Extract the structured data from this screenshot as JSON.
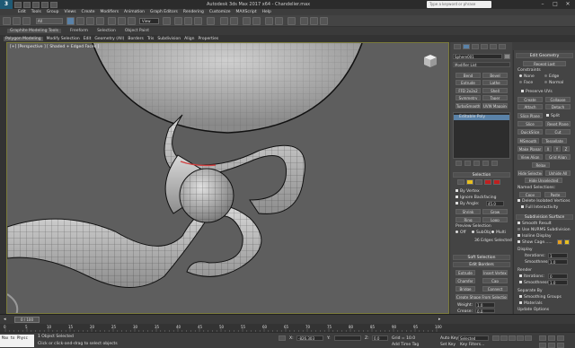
{
  "window": {
    "title": "Autodesk 3ds Max 2017 x64 - Chandelier.max",
    "logo": "3",
    "search_placeholder": "Type a keyword or phrase"
  },
  "menu": [
    "Edit",
    "Tools",
    "Group",
    "Views",
    "Create",
    "Modifiers",
    "Animation",
    "Graph Editors",
    "Rendering",
    "Customize",
    "MAXScript",
    "Help"
  ],
  "toolbar": {
    "selection_filter": "All",
    "view_dropdown": "View"
  },
  "ribbon": {
    "title": "Graphite Modeling Tools",
    "tabs": [
      "Freeform",
      "Selection",
      "Object Paint"
    ],
    "subtabs": [
      "Polygon Modeling",
      "Modify Selection",
      "Edit",
      "Geometry (All)",
      "Borders",
      "Tris",
      "Subdivision",
      "Align",
      "Properties"
    ]
  },
  "viewport": {
    "label": "[+] [Perspective ] [ Shaded + Edged Faces ]"
  },
  "command_panel": {
    "object_name": "Sphere001",
    "modifier_list": "Modifier List",
    "mod_buttons": [
      [
        "Bend",
        "Bevel"
      ],
      [
        "Extrude",
        "Lathe"
      ],
      [
        "FFD 2x2x2",
        "Shell"
      ],
      [
        "Symmetry",
        "Taper"
      ],
      [
        "TurboSmooth",
        "UVW Mapping Clr"
      ]
    ],
    "stack_item": "Editable Poly",
    "selection_header": "Selection",
    "by_vertex": "By Vertex",
    "ignore_backfacing": "Ignore Backfacing",
    "by_angle": "By Angle:",
    "angle_value": "45.0",
    "shrink": "Shrink",
    "grow": "Grow",
    "ring": "Ring",
    "loop": "Loop",
    "preview_label": "Preview Selection",
    "preview_off": "Off",
    "preview_subobj": "SubObj",
    "preview_multi": "Multi",
    "selected_status": "36 Edges Selected",
    "soft_selection": "Soft Selection",
    "edit_borders": "Edit Borders",
    "extrude": "Extrude",
    "insert_vertex": "Insert Vertex",
    "chamfer": "Chamfer",
    "cap": "Cap",
    "bridge": "Bridge",
    "connect": "Connect",
    "create_shape": "Create Shape From Selection",
    "weight_label": "Weight:",
    "weight_value": "1.0",
    "crease_label": "Crease:",
    "crease_value": "0.0",
    "edit_tri": "Edit Tri.",
    "turn": "Turn"
  },
  "right_panel": {
    "edit_geometry": "Edit Geometry",
    "repeat_last": "Repeat Last",
    "constraints": "Constraints",
    "none": "None",
    "edge": "Edge",
    "face": "Face",
    "normal": "Normal",
    "preserve_uvs": "Preserve UVs",
    "create": "Create",
    "collapse": "Collapse",
    "attach": "Attach",
    "detach": "Detach",
    "slice_plane": "Slice Plane",
    "split": "Split",
    "slice": "Slice",
    "reset_plane": "Reset Plane",
    "quickslice": "QuickSlice",
    "cut": "Cut",
    "msmooth": "MSmooth",
    "tessellate": "Tessellate",
    "make_planar": "Make Planar",
    "x": "X",
    "y": "Y",
    "z": "Z",
    "view_align": "View Align",
    "grid_align": "Grid Align",
    "relax": "Relax",
    "hide_selected": "Hide Selected",
    "unhide_all": "Unhide All",
    "hide_unselected": "Hide Unselected",
    "named_selections": "Named Selections:",
    "copy": "Copy",
    "paste": "Paste",
    "delete_isolated": "Delete Isolated Vertices",
    "full_interactivity": "Full Interactivity",
    "subdivision_surface": "Subdivision Surface",
    "smooth_result": "Smooth Result",
    "use_nurms": "Use NURMS Subdivision",
    "isoline_display": "Isoline Display",
    "show_cage": "Show Cage......",
    "display": "Display",
    "iterations": "Iterations:",
    "iter_value": "1",
    "smoothness": "Smoothness:",
    "smooth_value": "1.0",
    "render": "Render",
    "render_iter": "Iterations:",
    "render_iter_value": "0",
    "render_smooth": "Smoothness:",
    "render_smooth_value": "1.0",
    "separate_by": "Separate By",
    "smoothing_groups": "Smoothing Groups",
    "materials": "Materials",
    "update_options": "Update Options",
    "always": "Always",
    "when_rendering": "When Rendering",
    "manually": "Manually"
  },
  "timeline": {
    "frame": "0 / 100",
    "ticks": [
      "0",
      "5",
      "10",
      "15",
      "20",
      "25",
      "30",
      "35",
      "40",
      "45",
      "50",
      "55",
      "60",
      "65",
      "70",
      "75",
      "80",
      "85",
      "90",
      "95",
      "100"
    ]
  },
  "status": {
    "maxscript_line1": "Max to Physc",
    "maxscript_line2": "",
    "selection_status": "1 Object Selected",
    "prompt": "Click or click-and-drag to select objects",
    "x_label": "X:",
    "x_value": "-826.303",
    "y_label": "Y:",
    "y_value": "",
    "z_label": "Z:",
    "z_value": "0.0",
    "grid": "Grid = 10.0",
    "add_time_tag": "Add Time Tag",
    "autokey": "Auto Key",
    "selected": "Selected",
    "set_key": "Set Key",
    "key_filters": "Key Filters..."
  },
  "colors": {
    "accent": "#5a82a8",
    "selection_red": "#cc2222",
    "edge_highlight": "#d04040",
    "ground": "#5e5e5e"
  }
}
